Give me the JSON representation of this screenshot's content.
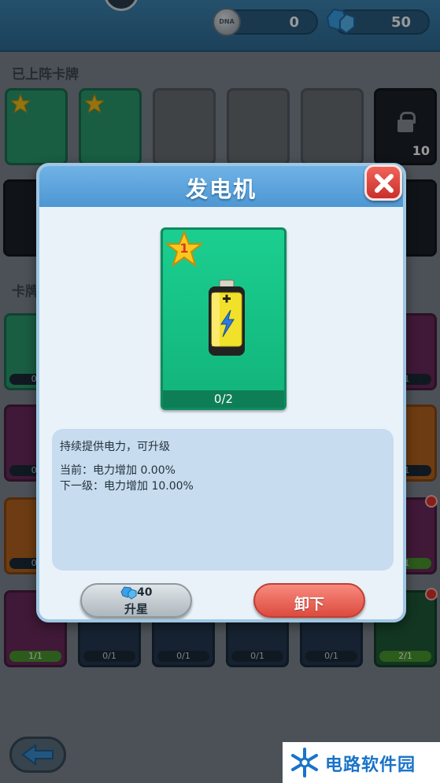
{
  "top": {
    "coins": "0",
    "gems": "50",
    "coin_label": "DNA"
  },
  "sections": {
    "equipped": "已上阵卡牌",
    "cards": "卡牌"
  },
  "locked_slot_cost": "10",
  "bg_progress": {
    "row1": [
      "0/",
      "/1"
    ],
    "row2": [
      "0/",
      "/1"
    ],
    "row3": [
      "0/",
      "/1"
    ],
    "row4": [
      "1/1",
      "0/1",
      "0/1",
      "0/1",
      "0/1",
      "2/1"
    ]
  },
  "dialog": {
    "title": "发电机",
    "card": {
      "level": "1",
      "progress": "0/2",
      "item_icon": "battery-icon"
    },
    "description": "持续提供电力，可升级",
    "current": "当前：电力增加 0.00%",
    "next": "下一级：电力增加 10.00%",
    "upgrade": {
      "cost": "40",
      "label": "升星"
    },
    "unequip_label": "卸下"
  },
  "watermark": "电路软件园",
  "colors": {
    "card_green": "#12b37a",
    "header_blue": "#4e97d3",
    "close_red": "#dd4b3f"
  }
}
